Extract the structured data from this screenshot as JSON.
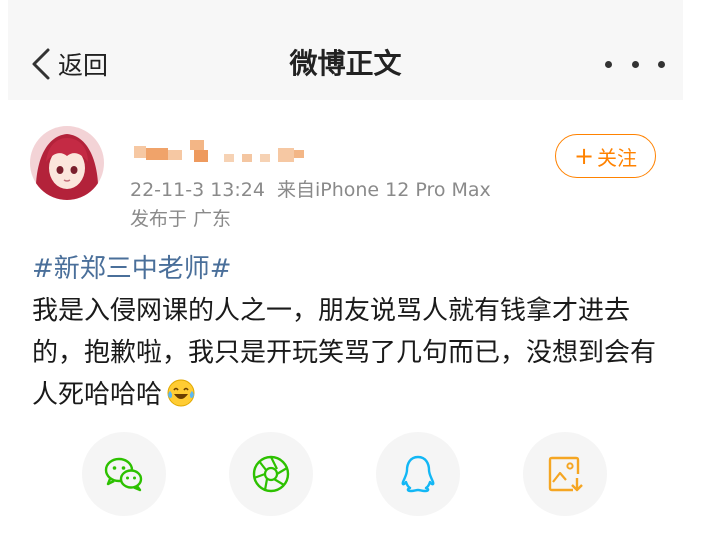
{
  "nav": {
    "back_label": "返回",
    "title": "微博正文"
  },
  "post": {
    "timestamp": "22-11-3 13:24",
    "source": "来自iPhone 12 Pro Max",
    "location": "发布于 广东",
    "follow_label": "关注",
    "hashtag": "#新郑三中老师#",
    "text": "我是入侵网课的人之一，朋友说骂人就有钱拿才进去的，抱歉啦，我只是开玩笑骂了几句而已，没想到会有人死哈哈哈"
  },
  "icons": {
    "back": "chevron-left-icon",
    "more": "more-dots-icon",
    "emoji": "laugh-cry-emoji-icon",
    "share": [
      "wechat-icon",
      "moments-icon",
      "qq-icon",
      "save-image-icon"
    ]
  },
  "colors": {
    "accent": "#ff8200",
    "hashtag": "#4a6f9a",
    "wechat": "#2dc100",
    "qq": "#12b7f5",
    "save": "#f5a623"
  }
}
